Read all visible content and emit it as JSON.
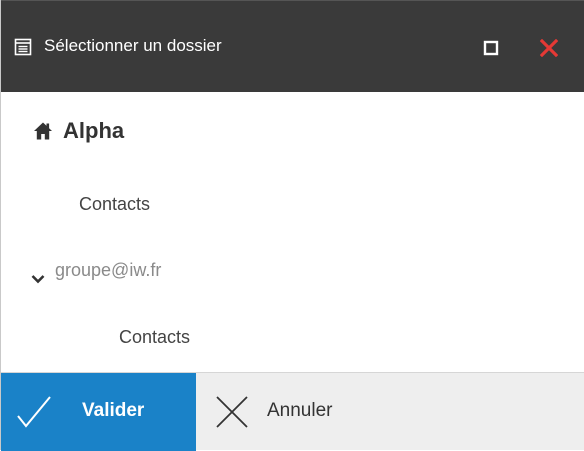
{
  "dialog": {
    "title": "Sélectionner un dossier",
    "title_icon": "folder-list-icon",
    "maximize_icon": "maximize-icon",
    "close_icon": "close-icon"
  },
  "tree": {
    "root_label": "Alpha",
    "root_icon": "home-icon",
    "items": [
      {
        "label": "Contacts",
        "level": 1
      },
      {
        "label": "groupe@iw.fr",
        "level": 1,
        "expanded": true,
        "icon": "chevron-down-icon"
      },
      {
        "label": "Contacts",
        "level": 2
      }
    ]
  },
  "footer": {
    "validate_label": "Valider",
    "validate_icon": "check-icon",
    "cancel_label": "Annuler",
    "cancel_icon": "x-icon"
  },
  "colors": {
    "titlebar": "#3a3a3a",
    "close_red": "#e53935",
    "validate_blue": "#1a82c8",
    "footer_bg": "#eeeeee"
  }
}
